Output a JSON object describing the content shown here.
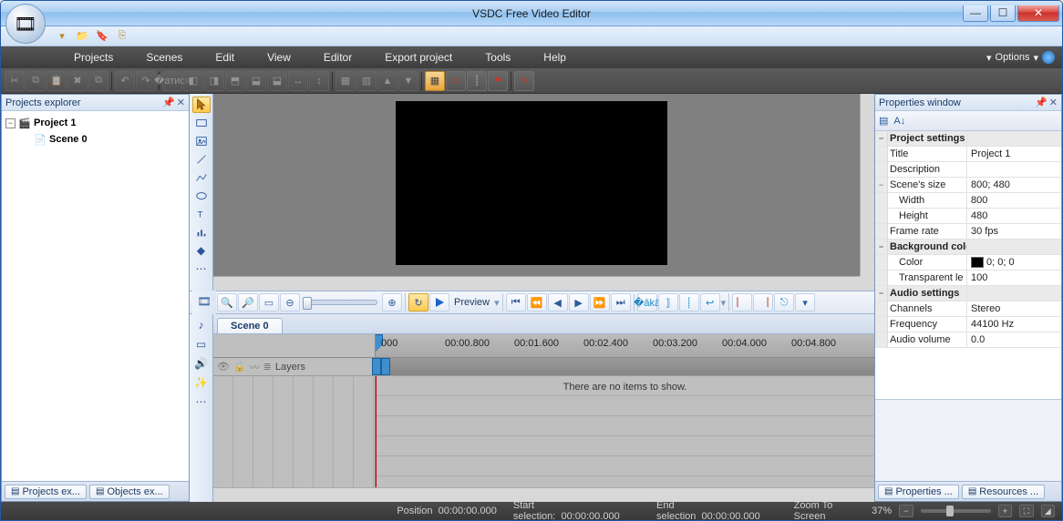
{
  "window": {
    "title": "VSDC Free Video Editor"
  },
  "wincontrols": {
    "min": "—",
    "max": "☐",
    "close": "✕"
  },
  "menu": {
    "items": [
      "Projects",
      "Scenes",
      "Edit",
      "View",
      "Editor",
      "Export project",
      "Tools",
      "Help"
    ],
    "options": "Options"
  },
  "panels": {
    "explorer_title": "Projects explorer",
    "properties_title": "Properties window"
  },
  "tree": {
    "root": "Project 1",
    "child": "Scene 0"
  },
  "timeline": {
    "scene_tab": "Scene 0",
    "layers_label": "Layers",
    "empty_msg": "There are no items to show.",
    "ticks": [
      "000",
      "00:00.800",
      "00:01.600",
      "00:02.400",
      "00:03.200",
      "00:04.000",
      "00:04.800"
    ],
    "preview_label": "Preview"
  },
  "properties": {
    "cat1": "Project settings",
    "title_k": "Title",
    "title_v": "Project 1",
    "desc_k": "Description",
    "desc_v": "",
    "size_k": "Scene's size",
    "size_v": "800; 480",
    "width_k": "Width",
    "width_v": "800",
    "height_k": "Height",
    "height_v": "480",
    "fps_k": "Frame rate",
    "fps_v": "30 fps",
    "cat2": "Background color",
    "color_k": "Color",
    "color_v": "0; 0; 0",
    "trans_k": "Transparent le",
    "trans_v": "100",
    "cat3": "Audio settings",
    "chan_k": "Channels",
    "chan_v": "Stereo",
    "freq_k": "Frequency",
    "freq_v": "44100 Hz",
    "vol_k": "Audio volume",
    "vol_v": "0.0"
  },
  "bottom_tabs": {
    "left1": "Projects ex...",
    "left2": "Objects ex...",
    "right1": "Properties ...",
    "right2": "Resources ..."
  },
  "status": {
    "position_k": "Position",
    "position_v": "00:00:00.000",
    "startsel_k": "Start selection:",
    "startsel_v": "00:00:00.000",
    "endsel_k": "End selection",
    "endsel_v": "00:00:00.000",
    "zoom_k": "Zoom To Screen",
    "zoom_pct": "37%"
  }
}
